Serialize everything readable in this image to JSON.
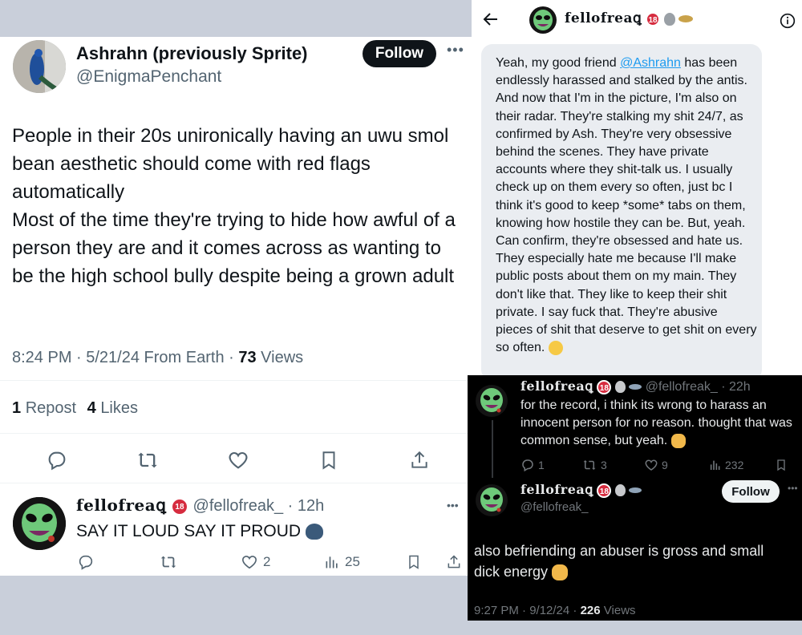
{
  "left_post": {
    "author_name": "Ashrahn (previously Sprite)",
    "author_handle": "@EnigmaPenchant",
    "follow_label": "Follow",
    "text": "People in their 20s unironically having an uwu smol bean aesthetic should come with red flags automatically\nMost of the time they're trying to hide how awful of a person they are and it comes across as wanting to be the high school bully despite being a grown adult",
    "meta_time": "8:24 PM · 5/21/24 From Earth ·",
    "views_count": "73",
    "views_label": "Views",
    "reposts_count": "1",
    "reposts_label": "Repost",
    "likes_count": "4",
    "likes_label": "Likes"
  },
  "left_reply": {
    "author_name": "fellofreaꝗ",
    "badge": "18",
    "author_handle": "@fellofreak_ · 12h",
    "text": "SAY IT LOUD SAY IT PROUD",
    "likes": "2",
    "views": "25"
  },
  "right_top": {
    "header_name": "fellofreaꝗ",
    "badge": "18",
    "msg_before_mention": "Yeah, my good friend ",
    "mention": "@Ashrahn",
    "msg_after_mention": " has been endlessly harassed and stalked by the antis. And now that I'm in the picture, I'm also on their radar. They're stalking my shit 24/7, as confirmed by Ash. They're very obsessive behind the scenes. They have private accounts where they shit-talk us. I usually check up on them every so often, just bc I think it's good to keep *some* tabs on them, knowing how hostile they can be. But, yeah. Can confirm, they're obsessed and hate us. They especially hate me because I'll make public posts about them on my main. They don't like that. They like to keep their shit private. I say fuck that. They're abusive pieces of shit that deserve to get shit on every so often."
  },
  "dark_reply": {
    "author_name": "fellofreaꝗ",
    "badge": "18",
    "author_handle": "@fellofreak_ · 22h",
    "text": "for the record, i think its wrong to harass an innocent person for no reason. thought that was common sense, but yeah.",
    "replies": "1",
    "reposts": "3",
    "likes": "9",
    "views": "232"
  },
  "dark_post": {
    "author_name": "fellofreaꝗ",
    "badge": "18",
    "author_handle": "@fellofreak_",
    "follow_label": "Follow",
    "text": "also befriending an abuser is gross and small dick energy",
    "meta_time": "9:27 PM · 9/12/24 ·",
    "views_count": "226",
    "views_label": "Views"
  },
  "colors": {
    "link": "#1d9bf0",
    "badge": "#d62c3f",
    "alien_green": "#6ec97a"
  },
  "icons": [
    "reply-icon",
    "repost-icon",
    "like-icon",
    "bookmark-icon",
    "share-icon",
    "views-icon",
    "more-icon",
    "back-icon",
    "info-icon",
    "alien-icon",
    "ufo-icon",
    "speaking-head-icon",
    "shrug-icon",
    "eye-roll-icon"
  ]
}
